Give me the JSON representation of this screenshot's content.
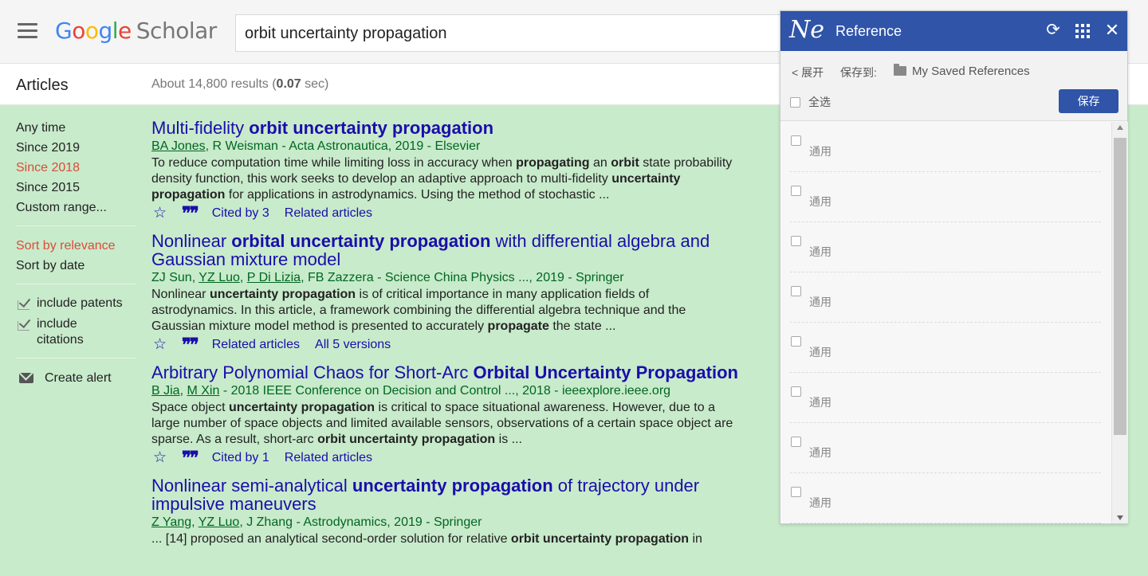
{
  "header": {
    "logo_google": [
      "G",
      "o",
      "o",
      "g",
      "l",
      "e"
    ],
    "logo_scholar": "Scholar",
    "search_query": "orbit uncertainty propagation"
  },
  "subheader": {
    "section": "Articles",
    "results_prefix": "About 14,800 results (",
    "results_time": "0.07",
    "results_suffix": " sec)"
  },
  "sidebar": {
    "time_filters": [
      "Any time",
      "Since 2019",
      "Since 2018",
      "Since 2015",
      "Custom range..."
    ],
    "active_time_filter": "Since 2018",
    "sort_options": [
      "Sort by relevance",
      "Sort by date"
    ],
    "active_sort": "Sort by relevance",
    "include_patents": "include patents",
    "include_citations_1": "include",
    "include_citations_2": "citations",
    "create_alert": "Create alert"
  },
  "results": [
    {
      "title_plain": "Multi-fidelity ",
      "title_bold": "orbit uncertainty propagation",
      "title_rest": "",
      "authors": [
        {
          "name": "BA Jones",
          "link": true
        },
        {
          "name": ", R Weisman - Acta Astronautica, 2019 - Elsevier",
          "link": false
        }
      ],
      "snippet": [
        [
          "To reduce computation time while limiting loss in accuracy when ",
          false
        ],
        [
          "propagating",
          true
        ],
        [
          " an ",
          false
        ],
        [
          "orbit",
          true
        ],
        [
          " state probability density function, this work seeks to develop an adaptive approach to multi-fidelity ",
          false
        ],
        [
          "uncertainty propagation",
          true
        ],
        [
          " for applications in astrodynamics. Using the method of stochastic ...",
          false
        ]
      ],
      "actions": [
        "Cited by 3",
        "Related articles"
      ]
    },
    {
      "title_plain": "Nonlinear ",
      "title_bold": "orbital uncertainty propagation",
      "title_rest": " with differential algebra and Gaussian mixture model",
      "authors": [
        {
          "name": "ZJ Sun, ",
          "link": false
        },
        {
          "name": "YZ Luo",
          "link": true
        },
        {
          "name": ", ",
          "link": false
        },
        {
          "name": "P Di Lizia",
          "link": true
        },
        {
          "name": ", FB Zazzera - Science China Physics ..., 2019 - Springer",
          "link": false
        }
      ],
      "snippet": [
        [
          "Nonlinear ",
          false
        ],
        [
          "uncertainty propagation",
          true
        ],
        [
          " is of critical importance in many application fields of astrodynamics. In this article, a framework combining the differential algebra technique and the Gaussian mixture model method is presented to accurately ",
          false
        ],
        [
          "propagate",
          true
        ],
        [
          " the state ...",
          false
        ]
      ],
      "actions": [
        "Related articles",
        "All 5 versions"
      ]
    },
    {
      "title_plain": "Arbitrary Polynomial Chaos for Short-Arc ",
      "title_bold": "Orbital Uncertainty Propagation",
      "title_rest": "",
      "authors": [
        {
          "name": "B Jia",
          "link": true
        },
        {
          "name": ", ",
          "link": false
        },
        {
          "name": "M Xin",
          "link": true
        },
        {
          "name": " - 2018 IEEE Conference on Decision and Control ..., 2018 - ieeexplore.ieee.org",
          "link": false
        }
      ],
      "snippet": [
        [
          "Space object ",
          false
        ],
        [
          "uncertainty propagation",
          true
        ],
        [
          " is critical to space situational awareness. However, due to a large number of space objects and limited available sensors, observations of a certain space object are sparse. As a result, short-arc ",
          false
        ],
        [
          "orbit uncertainty propagation",
          true
        ],
        [
          " is ...",
          false
        ]
      ],
      "actions": [
        "Cited by 1",
        "Related articles"
      ]
    },
    {
      "title_plain": "Nonlinear semi-analytical ",
      "title_bold": "uncertainty propagation",
      "title_rest": " of trajectory under impulsive maneuvers",
      "authors": [
        {
          "name": "Z Yang",
          "link": true
        },
        {
          "name": ", ",
          "link": false
        },
        {
          "name": "YZ Luo",
          "link": true
        },
        {
          "name": ", J Zhang - Astrodynamics, 2019 - Springer",
          "link": false
        }
      ],
      "snippet": [
        [
          "... [14] proposed an analytical second-order solution for relative ",
          false
        ],
        [
          "orbit uncertainty propagation",
          true
        ],
        [
          " in",
          false
        ]
      ],
      "actions": []
    }
  ],
  "ref_panel": {
    "logo": "Ne",
    "title": "Reference",
    "expand": "< 展开",
    "save_to_label": "保存到:",
    "save_to_value": "My Saved References",
    "select_all": "全选",
    "save_button": "保存",
    "items": [
      "通用",
      "通用",
      "通用",
      "通用",
      "通用",
      "通用",
      "通用",
      "通用"
    ],
    "accent_color": "#2f54a8"
  }
}
